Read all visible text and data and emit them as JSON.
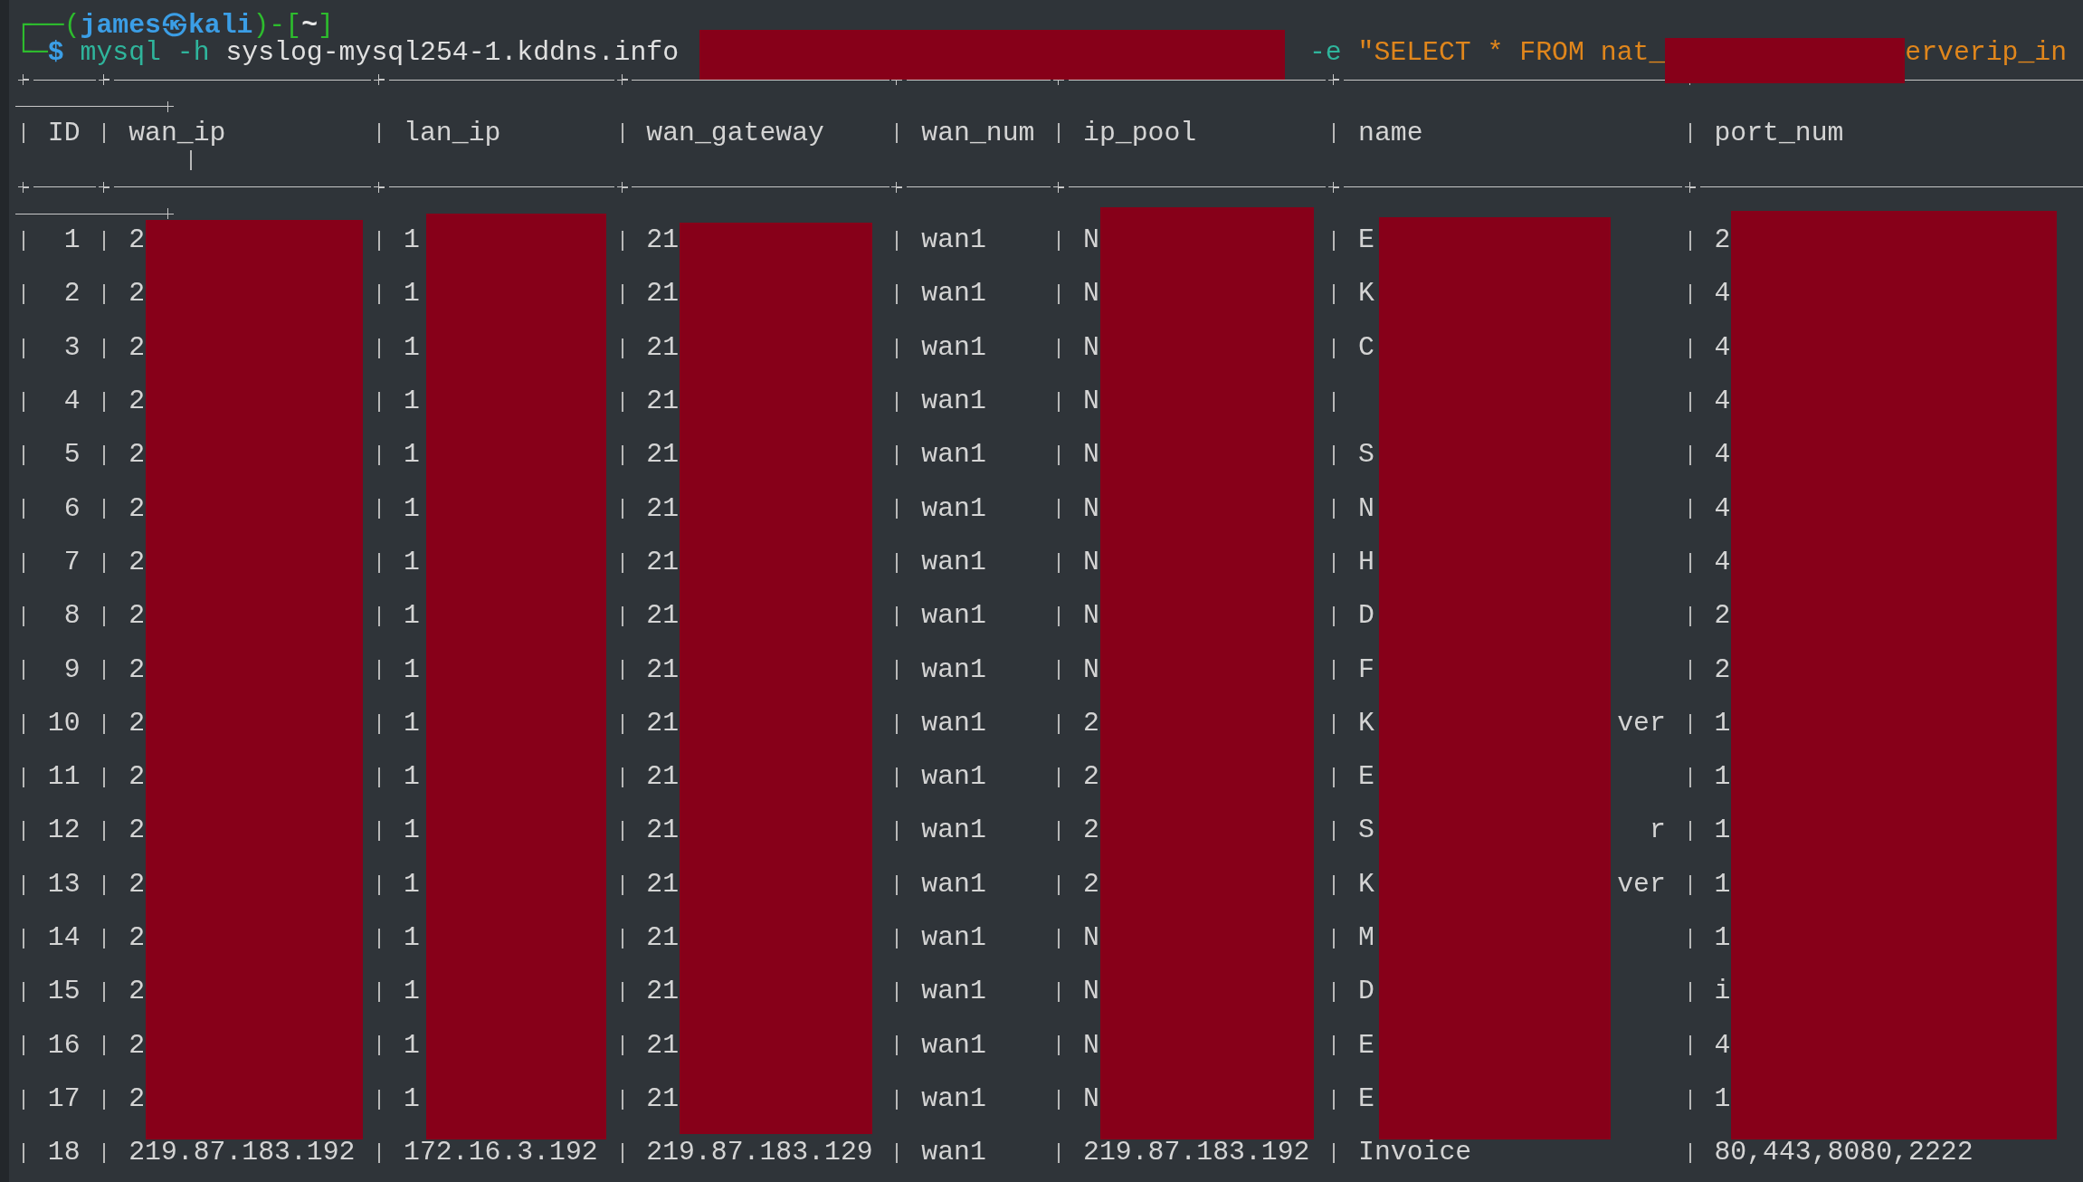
{
  "prompt": {
    "frame_top": "┌──(",
    "user": "james㉿kali",
    "frame_mid": ")-[",
    "path": "~",
    "frame_end": "]",
    "frame_bottom": "└─",
    "symbol": "$"
  },
  "command": [
    {
      "kind": "command",
      "text": "mysql"
    },
    {
      "kind": "option",
      "text": "-h"
    },
    {
      "kind": "argument",
      "text": "syslog-mysql254-1.kddns.info"
    },
    {
      "kind": "redacted"
    },
    {
      "kind": "option",
      "text": "-e"
    },
    {
      "kind": "string",
      "text": "\"SELECT * FROM nat_"
    },
    {
      "kind": "redacted"
    },
    {
      "kind": "string",
      "text": "erverip_in"
    }
  ],
  "table": {
    "columns": [
      {
        "label": "ID"
      },
      {
        "label": "wan_ip"
      },
      {
        "label": "lan_ip"
      },
      {
        "label": "wan_gateway"
      },
      {
        "label": "wan_num"
      },
      {
        "label": "ip_pool"
      },
      {
        "label": "name"
      },
      {
        "label": "port_num"
      }
    ],
    "rows": [
      {
        "redacted": true,
        "cells": [
          "1",
          "2",
          "1",
          "21",
          "wan1",
          "N",
          "E",
          "2"
        ]
      },
      {
        "redacted": true,
        "cells": [
          "2",
          "2",
          "1",
          "21",
          "wan1",
          "N",
          "K",
          "4"
        ]
      },
      {
        "redacted": true,
        "cells": [
          "3",
          "2",
          "1",
          "21",
          "wan1",
          "N",
          "C",
          "4"
        ]
      },
      {
        "redacted": true,
        "cells": [
          "4",
          "2",
          "1",
          "21",
          "wan1",
          "N",
          null,
          "4"
        ]
      },
      {
        "redacted": true,
        "cells": [
          "5",
          "2",
          "1",
          "21",
          "wan1",
          "N",
          "S",
          "4"
        ]
      },
      {
        "redacted": true,
        "cells": [
          "6",
          "2",
          "1",
          "21",
          "wan1",
          "N",
          "N",
          "4"
        ]
      },
      {
        "redacted": true,
        "cells": [
          "7",
          "2",
          "1",
          "21",
          "wan1",
          "N",
          "H",
          "4"
        ]
      },
      {
        "redacted": true,
        "cells": [
          "8",
          "2",
          "1",
          "21",
          "wan1",
          "N",
          "D",
          "2"
        ]
      },
      {
        "redacted": true,
        "cells": [
          "9",
          "2",
          "1",
          "21",
          "wan1",
          "N",
          "F",
          "2"
        ]
      },
      {
        "redacted": true,
        "cells": [
          "10",
          "2",
          "1",
          "21",
          "wan1",
          "2",
          {
            "start": "K",
            "end": "ver"
          },
          "1"
        ]
      },
      {
        "redacted": true,
        "cells": [
          "11",
          "2",
          "1",
          "21",
          "wan1",
          "2",
          "E",
          "1"
        ]
      },
      {
        "redacted": true,
        "cells": [
          "12",
          "2",
          "1",
          "21",
          "wan1",
          "2",
          {
            "start": "S",
            "end": "r"
          },
          "1"
        ]
      },
      {
        "redacted": true,
        "cells": [
          "13",
          "2",
          "1",
          "21",
          "wan1",
          "2",
          {
            "start": "K",
            "end": "ver"
          },
          "1"
        ]
      },
      {
        "redacted": true,
        "cells": [
          "14",
          "2",
          "1",
          "21",
          "wan1",
          "N",
          "M",
          "1"
        ]
      },
      {
        "redacted": true,
        "cells": [
          "15",
          "2",
          "1",
          "21",
          "wan1",
          "N",
          "D",
          "i"
        ]
      },
      {
        "redacted": true,
        "cells": [
          "16",
          "2",
          "1",
          "21",
          "wan1",
          "N",
          "E",
          "4"
        ]
      },
      {
        "redacted": true,
        "cells": [
          "17",
          "2",
          "1",
          "21",
          "wan1",
          "N",
          "E",
          "1"
        ]
      },
      {
        "redacted": false,
        "cells": [
          "18",
          "219.87.183.192",
          "172.16.3.192",
          "219.87.183.129",
          "wan1",
          "219.87.183.192",
          "Invoice",
          "80,443,8080,2222"
        ]
      }
    ]
  }
}
